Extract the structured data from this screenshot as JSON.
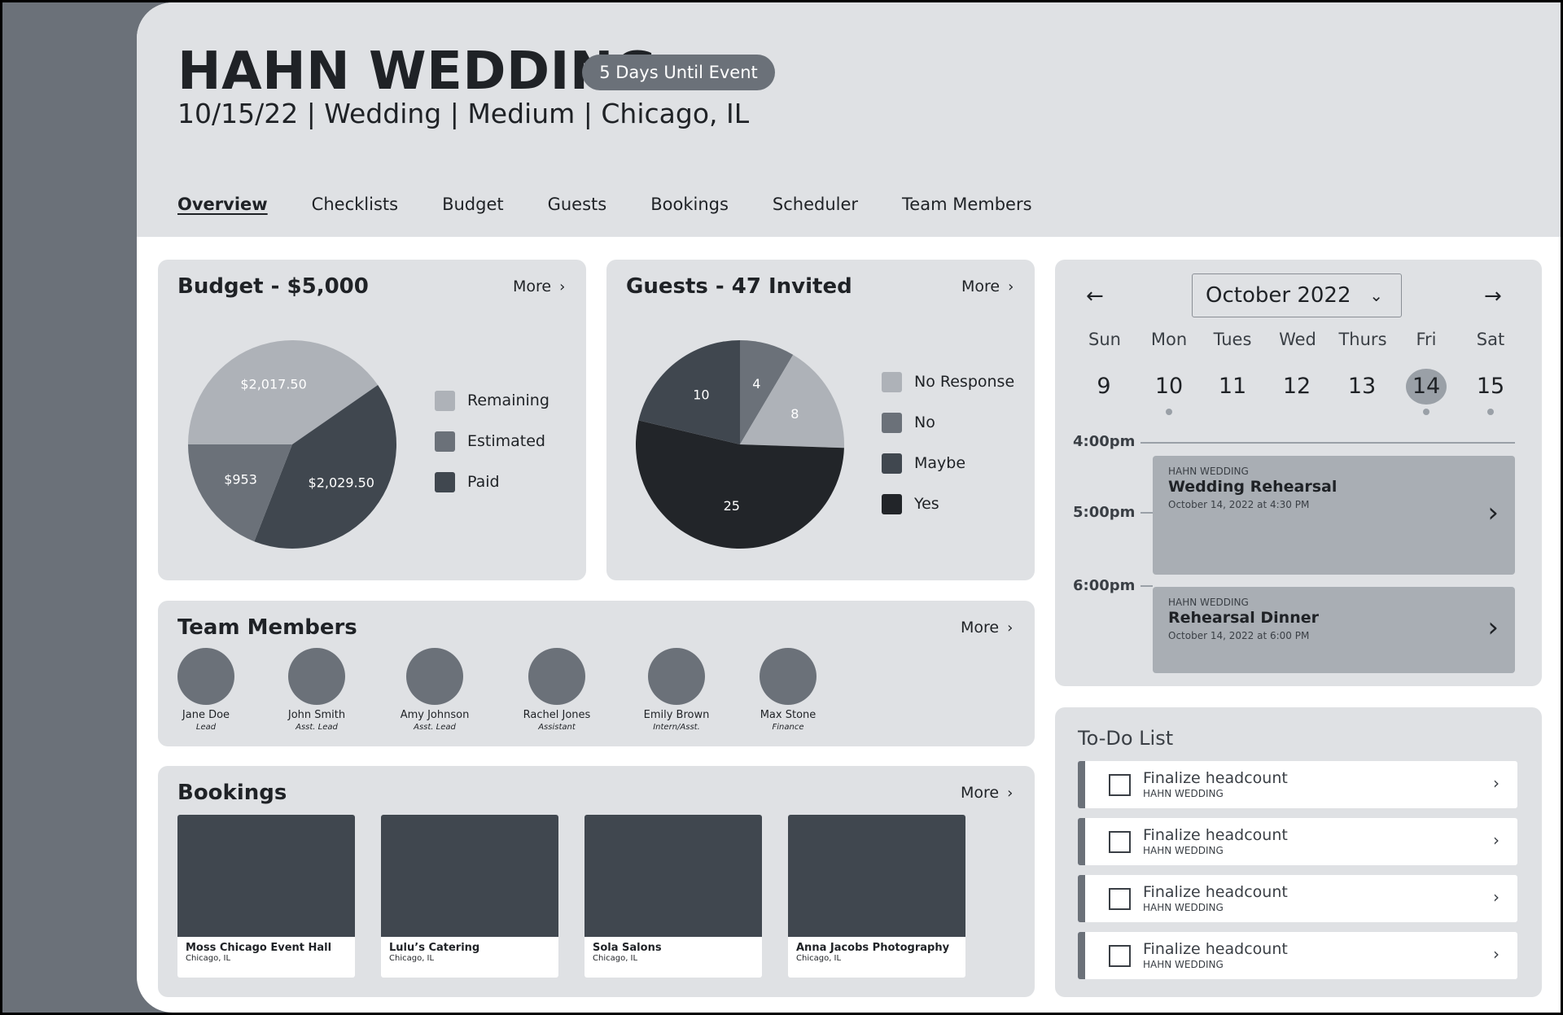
{
  "header": {
    "title": "HAHN WEDDING",
    "countdown": "5 Days Until Event",
    "subtitle": "10/15/22 | Wedding | Medium | Chicago, IL"
  },
  "tabs": [
    {
      "label": "Overview",
      "active": true
    },
    {
      "label": "Checklists",
      "active": false
    },
    {
      "label": "Budget",
      "active": false
    },
    {
      "label": "Guests",
      "active": false
    },
    {
      "label": "Bookings",
      "active": false
    },
    {
      "label": "Scheduler",
      "active": false
    },
    {
      "label": "Team Members",
      "active": false
    }
  ],
  "more_label": "More",
  "budget": {
    "title": "Budget - $5,000",
    "legend": [
      "Remaining",
      "Estimated",
      "Paid"
    ],
    "colors": {
      "Remaining": "#aeb2b8",
      "Estimated": "#6b7179",
      "Paid": "#40474f"
    }
  },
  "guests": {
    "title": "Guests - 47 Invited",
    "legend": [
      "No Response",
      "No",
      "Maybe",
      "Yes"
    ],
    "colors": {
      "No Response": "#aeb2b8",
      "No": "#6b7179",
      "Maybe": "#40474f",
      "Yes": "#222529"
    }
  },
  "chart_data": [
    {
      "type": "pie",
      "title": "Budget - $5,000",
      "categories": [
        "Remaining",
        "Estimated",
        "Paid"
      ],
      "values": [
        2017.5,
        953,
        2029.5
      ],
      "labels": [
        "$2,017.50",
        "$953",
        "$2,029.50"
      ]
    },
    {
      "type": "pie",
      "title": "Guests - 47 Invited",
      "categories": [
        "No Response",
        "No",
        "Maybe",
        "Yes"
      ],
      "values": [
        8,
        4,
        10,
        25
      ],
      "labels": [
        "8",
        "4",
        "10",
        "25"
      ]
    }
  ],
  "team": {
    "title": "Team Members",
    "members": [
      {
        "name": "Jane Doe",
        "role": "Lead"
      },
      {
        "name": "John Smith",
        "role": "Asst. Lead"
      },
      {
        "name": "Amy Johnson",
        "role": "Asst. Lead"
      },
      {
        "name": "Rachel Jones",
        "role": "Assistant"
      },
      {
        "name": "Emily Brown",
        "role": "Intern/Asst."
      },
      {
        "name": "Max Stone",
        "role": "Finance"
      }
    ]
  },
  "bookings": {
    "title": "Bookings",
    "items": [
      {
        "name": "Moss Chicago Event Hall",
        "location": "Chicago, IL"
      },
      {
        "name": "Lulu’s Catering",
        "location": "Chicago, IL"
      },
      {
        "name": "Sola Salons",
        "location": "Chicago, IL"
      },
      {
        "name": "Anna Jacobs Photography",
        "location": "Chicago, IL"
      }
    ]
  },
  "calendar": {
    "month": "October",
    "year": "2022",
    "weekdays": [
      "Sun",
      "Mon",
      "Tues",
      "Wed",
      "Thurs",
      "Fri",
      "Sat"
    ],
    "days": [
      "9",
      "10",
      "11",
      "12",
      "13",
      "14",
      "15"
    ],
    "selected_day": "14",
    "days_with_events": [
      "10",
      "14",
      "15"
    ],
    "times": [
      "4:00pm",
      "5:00pm",
      "6:00pm"
    ],
    "events": [
      {
        "client": "HAHN WEDDING",
        "title": "Wedding Rehearsal",
        "time": "October 14, 2022 at 4:30 PM"
      },
      {
        "client": "HAHN WEDDING",
        "title": "Rehearsal Dinner",
        "time": "October 14, 2022 at 6:00 PM"
      }
    ]
  },
  "todo": {
    "title": "To-Do List",
    "items": [
      {
        "text": "Finalize headcount",
        "client": "HAHN WEDDING"
      },
      {
        "text": "Finalize headcount",
        "client": "HAHN WEDDING"
      },
      {
        "text": "Finalize headcount",
        "client": "HAHN WEDDING"
      },
      {
        "text": "Finalize headcount",
        "client": "HAHN WEDDING"
      }
    ]
  }
}
